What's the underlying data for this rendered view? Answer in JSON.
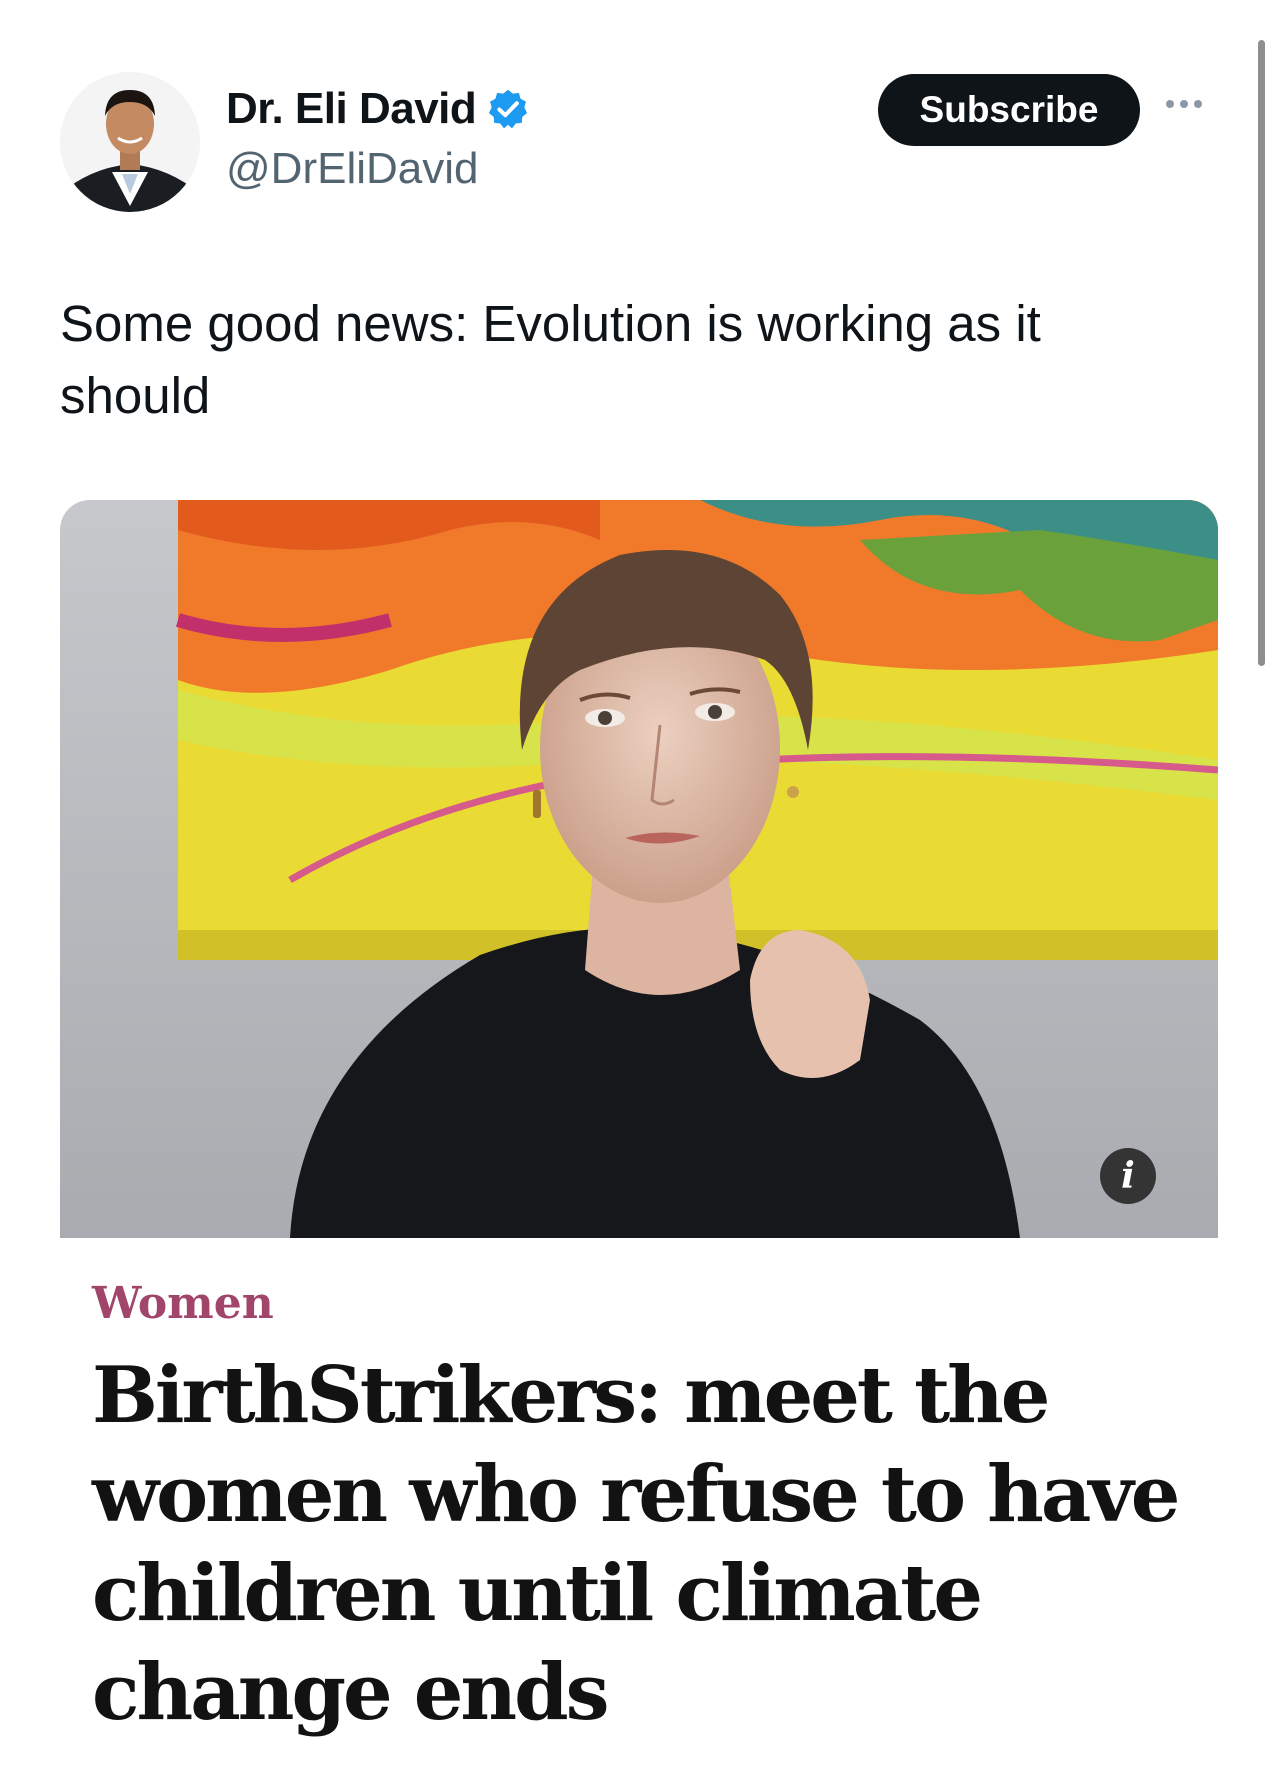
{
  "author": {
    "display_name": "Dr. Eli David",
    "handle": "@DrEliDavid",
    "verified": true,
    "avatar_icon": "profile-photo"
  },
  "actions": {
    "subscribe_label": "Subscribe",
    "more_icon": "more-dots-icon"
  },
  "tweet": {
    "text": "Some good news: Evolution is working as it should"
  },
  "media": {
    "info_label": "i",
    "article": {
      "section": "Women",
      "headline": "BirthStrikers: meet the women who refuse to have children until climate change ends"
    }
  },
  "colors": {
    "section": "#a1456b",
    "verified_badge": "#1d9bf0",
    "subscribe_bg": "#0f1419"
  }
}
